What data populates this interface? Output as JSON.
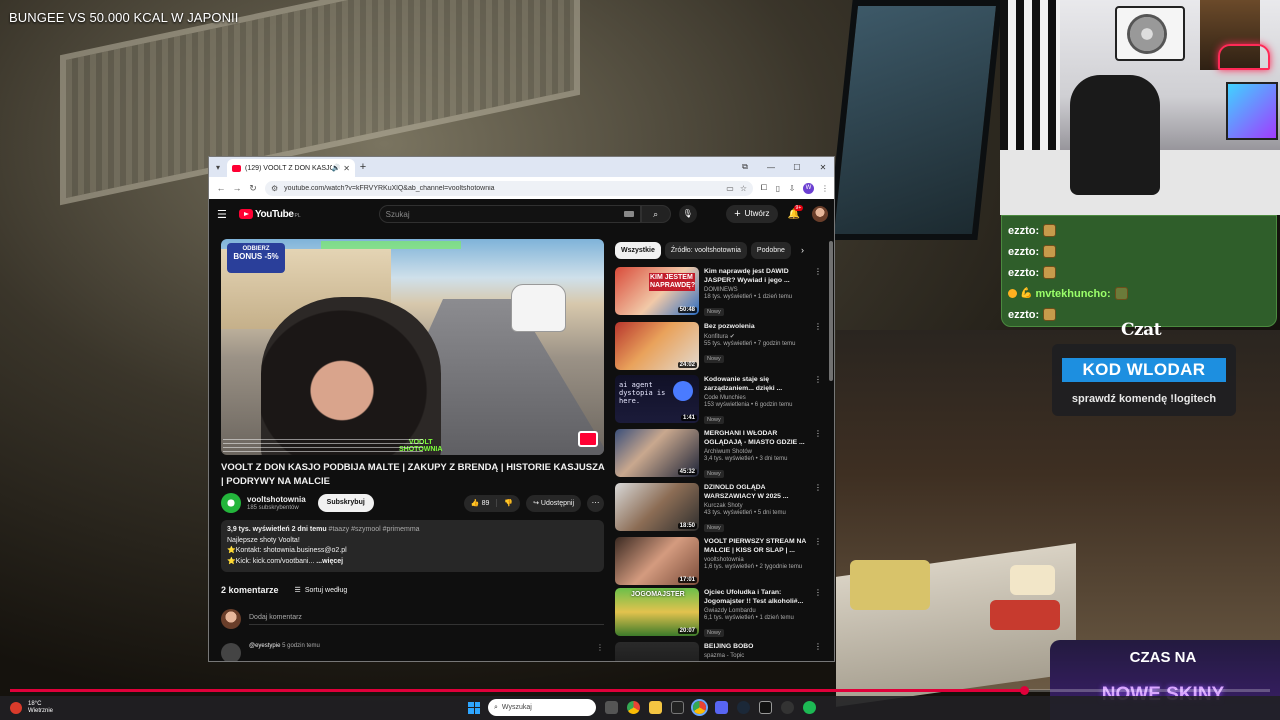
{
  "stream": {
    "title": "BUNGEE VS 50.000 KCAL W JAPONII",
    "chat_title": "Czat",
    "code": "KOD WLODAR",
    "code_hint": "sprawdź komendę !logitech",
    "promo_line1": "CZAS NA",
    "promo_line2": "NOWE SKINY",
    "progress_fraction": 0.805
  },
  "chat": {
    "messages": [
      {
        "user": "ezzto:",
        "emote": "emote-icon"
      },
      {
        "user": "ezzto:",
        "emote": "emote-icon"
      },
      {
        "user": "ezzto:",
        "emote": "emote-icon"
      },
      {
        "user": "mvtekhuncho:",
        "emote": "emote-icon"
      },
      {
        "user": "ezzto:",
        "emote": "emote-icon"
      }
    ]
  },
  "browser": {
    "tab_title": "(129) VOOLT Z DON KASJO",
    "url": "youtube.com/watch?v=kFRVYRKuXlQ&ab_channel=vooltshotownia",
    "profile_letter": "W"
  },
  "youtube": {
    "logo_text": "YouTube",
    "logo_cc": "PL",
    "search_placeholder": "Szukaj",
    "create_label": "Utwórz",
    "notif_count": "9+",
    "video_title": "VOOLT Z DON KASJO PODBIJA MALTE | ZAKUPY Z BRENDĄ | HISTORIE KASJUSZA | PODRYWY NA MALCIE",
    "channel_name": "vooltshotownia",
    "channel_subs": "185 subskrybentów",
    "subscribe_label": "Subskrybuj",
    "likes": "89",
    "share_label": "Udostępnij",
    "desc_meta": "3,9 tys. wyświetleń  2 dni temu",
    "desc_tags": "#taazy #szymool #primemma",
    "desc_line2": "Najlepsze shoty Voolta!",
    "desc_line3": "⭐Kontakt: shotownia.business@o2.pl",
    "desc_line4": "⭐Kick: kick.com/vootbani...",
    "desc_more": "...więcej",
    "comments_count": "2 komentarze",
    "sort_label": "Sortuj według",
    "add_comment_placeholder": "Dodaj komentarz",
    "comment_user": "@eyestypie",
    "comment_time": "5 godzin temu",
    "player_badge_top": "ODBIERZ",
    "player_badge_main": "BONUS -5%",
    "player_watermark_1": "VOOLT",
    "player_watermark_2": "SHOTOWNIA"
  },
  "chips": [
    "Wszystkie",
    "Źródło: vooltshotownia",
    "Podobne"
  ],
  "recommendations": [
    {
      "title": "Kim naprawdę jest DAWID JASPER? Wywiad i jego ...",
      "channel": "DOMINEWS",
      "meta": "18 tys. wyświetleń • 1 dzień temu",
      "badge": "Nowy",
      "duration": "50:48",
      "thumb_text": "KIM JESTEM NAPRAWDĘ?"
    },
    {
      "title": "Bez pozwolenia",
      "channel": "Konfitura",
      "meta": "55 tys. wyświetleń • 7 godzin temu",
      "badge": "Nowy",
      "duration": "24:02",
      "thumb_text": ""
    },
    {
      "title": "Kodowanie staje się zarządzaniem... dzięki ...",
      "channel": "Code Munchies",
      "meta": "153 wyświetlenia • 6 godzin temu",
      "badge": "Nowy",
      "duration": "1:41",
      "thumb_text": "ai agent dystopia is here."
    },
    {
      "title": "MERGHANI I WŁODAR OGLĄDAJĄ - MIASTO GDZIE ...",
      "channel": "Archiwum Shotów",
      "meta": "3,4 tys. wyświetleń • 3 dni temu",
      "badge": "Nowy",
      "duration": "45:32",
      "thumb_text": ""
    },
    {
      "title": "DZINOLD OGLĄDA WARSZAWIACY W 2025 ...",
      "channel": "Kurczak Shoty",
      "meta": "43 tys. wyświetleń • 5 dni temu",
      "badge": "Nowy",
      "duration": "18:50",
      "thumb_text": ""
    },
    {
      "title": "VOOLT PIERWSZY STREAM NA MALCIE | KISS OR SLAP | ...",
      "channel": "vooltshotownia",
      "meta": "1,6 tys. wyświetleń • 2 tygodnie temu",
      "badge": "",
      "duration": "17:01",
      "thumb_text": ""
    },
    {
      "title": "Ojciec Ufoludka i Taran: Jogomajster !! Test alkoholi#...",
      "channel": "Gwiazdy Lombardu",
      "meta": "6,1 tys. wyświetleń • 1 dzień temu",
      "badge": "Nowy",
      "duration": "20:07",
      "thumb_text": "JOGOMAJSTER"
    },
    {
      "title": "BEIJING BOBO",
      "channel": "spazma - Topic",
      "meta": "",
      "badge": "",
      "duration": "",
      "thumb_text": ""
    }
  ],
  "taskbar": {
    "temp": "18°C",
    "weather": "Wietrznie",
    "search_placeholder": "Wyszukaj"
  },
  "colors": {
    "yt_red": "#ff0033",
    "chat_green": "#2f5e2a",
    "code_blue": "#1d8fe0",
    "progress_red": "#e0003a"
  }
}
